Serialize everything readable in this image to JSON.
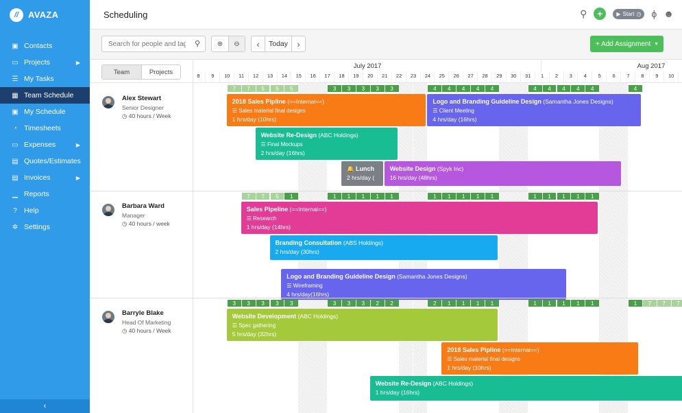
{
  "app": {
    "brand": "AVAZA",
    "logo_letter": "//"
  },
  "sidebar": {
    "items": [
      {
        "label": "Contacts",
        "icon": "contact-card-icon"
      },
      {
        "label": "Projects",
        "icon": "folder-icon",
        "has_submenu": true
      },
      {
        "label": "My Tasks",
        "icon": "task-list-icon"
      },
      {
        "label": "Team Schedule",
        "icon": "calendar-icon",
        "active": true
      },
      {
        "label": "My Schedule",
        "icon": "calendar-check-icon"
      },
      {
        "label": "Timesheets",
        "icon": "stopwatch-icon"
      },
      {
        "label": "Expenses",
        "icon": "receipt-icon",
        "has_submenu": true
      },
      {
        "label": "Quotes/Estimates",
        "icon": "document-icon"
      },
      {
        "label": "Invoices",
        "icon": "invoice-icon",
        "has_submenu": true
      },
      {
        "label": "Reports",
        "icon": "chart-icon"
      },
      {
        "label": "Help",
        "icon": "help-icon"
      },
      {
        "label": "Settings",
        "icon": "gear-icon"
      }
    ],
    "collapse_glyph": "‹"
  },
  "header": {
    "title": "Scheduling",
    "timer_label": "Start"
  },
  "toolbar": {
    "search_placeholder": "Search for people and tags...",
    "today_label": "Today",
    "add_label": "+ Add Assignment"
  },
  "tabs": {
    "team": "Team",
    "projects": "Projects"
  },
  "timeline": {
    "months": [
      {
        "label": "July 2017",
        "start_index": 0,
        "span": 24
      },
      {
        "label": "Aug 2017",
        "start_index": 24,
        "span": 10
      }
    ],
    "days": [
      "8",
      "9",
      "10",
      "11",
      "12",
      "13",
      "14",
      "15",
      "16",
      "17",
      "18",
      "19",
      "20",
      "21",
      "22",
      "23",
      "24",
      "25",
      "26",
      "27",
      "28",
      "29",
      "30",
      "31",
      "1",
      "2",
      "3",
      "4",
      "5",
      "6",
      "7",
      "8",
      "9",
      "10"
    ]
  },
  "people": [
    {
      "name": "Alex Stewart",
      "role": "Senior Designer",
      "hours": "40 hours / Week",
      "availability": [
        {
          "start": 2,
          "values": [
            "7",
            "7",
            "5",
            "5",
            "5"
          ],
          "shade": [
            "light",
            "light",
            "light",
            "light",
            "light"
          ]
        },
        {
          "start": 9,
          "values": [
            "3",
            "3",
            "3",
            "3",
            "3"
          ],
          "shade": [
            "dark",
            "dark",
            "dark",
            "dark",
            "dark"
          ]
        },
        {
          "start": 16,
          "values": [
            "4",
            "4",
            "4",
            "4",
            "4"
          ],
          "shade": [
            "dark",
            "dark",
            "dark",
            "dark",
            "dark"
          ]
        },
        {
          "start": 23,
          "values": [
            "4",
            "4",
            "4",
            "4",
            "4"
          ],
          "shade": [
            "dark",
            "dark",
            "dark",
            "dark",
            "dark"
          ]
        },
        {
          "start": 30,
          "values": [
            "4"
          ],
          "shade": [
            "dark"
          ]
        }
      ],
      "assignments": [
        {
          "title": "2018 Sales Pipline",
          "client": "(==Internal==)",
          "task": "Sales material final designs",
          "hours": "1 hrs/day (10hrs)",
          "color": "#f97b16",
          "start": 2,
          "end": 16,
          "lane": 0
        },
        {
          "title": "Logo and Branding Guideline Design",
          "client": "(Samantha Jones Designs)",
          "task": "Client Meeting",
          "hours": "4 hrs/day (16hrs)",
          "color": "#6764ee",
          "start": 16,
          "end": 31,
          "lane": 0
        },
        {
          "title": "Website Re-Design",
          "client": "(ABC Holdings)",
          "task": "Final Mockups",
          "hours": "2 hrs/day (16hrs)",
          "color": "#19bd94",
          "start": 4,
          "end": 14,
          "lane": 1
        },
        {
          "title": "Lunch",
          "client": "",
          "task": "",
          "hours": "2 hrs/day (",
          "color": "#7b8087",
          "start": 10,
          "end": 13,
          "lane": 2,
          "icon": "bell-icon"
        },
        {
          "title": "Website Design",
          "client": "(Spyk Inc)",
          "task": "",
          "hours": "16 hrs/day (48hrs)",
          "color": "#b657e0",
          "start": 13,
          "end": 29.6,
          "lane": 2
        }
      ]
    },
    {
      "name": "Barbara Ward",
      "role": "Manager",
      "hours": "40 hours / week",
      "availability": [
        {
          "start": 3,
          "values": [
            "7",
            "7",
            "5",
            "1"
          ],
          "shade": [
            "light",
            "light",
            "light",
            "dark"
          ]
        },
        {
          "start": 9,
          "values": [
            "1",
            "1",
            "1",
            "1",
            "1"
          ],
          "shade": [
            "dark",
            "dark",
            "dark",
            "dark",
            "dark"
          ]
        },
        {
          "start": 16,
          "values": [
            "1",
            "1",
            "1",
            "1",
            "1"
          ],
          "shade": [
            "dark",
            "dark",
            "dark",
            "dark",
            "dark"
          ]
        },
        {
          "start": 23,
          "values": [
            "1",
            "1",
            "1",
            "1",
            "1"
          ],
          "shade": [
            "dark",
            "dark",
            "dark",
            "dark",
            "dark"
          ]
        }
      ],
      "assignments": [
        {
          "title": "Sales Pipeline",
          "client": "(==Internal==)",
          "task": "Research",
          "hours": "1 hrs/day (14hrs)",
          "color": "#e33c96",
          "start": 3,
          "end": 28,
          "lane": 0
        },
        {
          "title": "Branding Consultation",
          "client": "(ABS Holdings)",
          "task": "",
          "hours": "2 hrs/day (30hrs)",
          "color": "#18aaf0",
          "start": 5,
          "end": 21,
          "lane": 1
        },
        {
          "title": "Logo and Branding Guideline Design",
          "client": "(Samantha Jones Designs)",
          "task": "Wireframing",
          "hours": "4 hrs/day(16hrs)",
          "color": "#6764ee",
          "start": 5.8,
          "end": 25.8,
          "lane": 2
        }
      ]
    },
    {
      "name": "Barryle Blake",
      "role": "Head Of Marketing",
      "hours": "40 hours / Week",
      "availability": [
        {
          "start": 2,
          "values": [
            "3",
            "3",
            "3",
            "3",
            "3"
          ],
          "shade": [
            "dark",
            "dark",
            "dark",
            "dark",
            "dark"
          ]
        },
        {
          "start": 9,
          "values": [
            "3",
            "3",
            "3",
            "2",
            "2"
          ],
          "shade": [
            "dark",
            "dark",
            "dark",
            "dark",
            "dark"
          ]
        },
        {
          "start": 16,
          "values": [
            "2",
            "1",
            "1",
            "1",
            "1"
          ],
          "shade": [
            "dark",
            "dark",
            "dark",
            "dark",
            "dark"
          ]
        },
        {
          "start": 23,
          "values": [
            "1",
            "1",
            "1",
            "1",
            "1"
          ],
          "shade": [
            "dark",
            "dark",
            "dark",
            "dark",
            "dark"
          ]
        },
        {
          "start": 30,
          "values": [
            "1",
            "7",
            "7",
            "7"
          ],
          "shade": [
            "dark",
            "light",
            "light",
            "light"
          ]
        }
      ],
      "assignments": [
        {
          "title": "Website Development",
          "client": "(ABC Holdings)",
          "task": "Spec gathering",
          "hours": "5 hrs/day (32hrs)",
          "color": "#a4c93a",
          "start": 2,
          "end": 21,
          "lane": 0
        },
        {
          "title": "2018 Sales Pipline",
          "client": "(==Internal==)",
          "task": "Sales material final designs",
          "hours": "1 hrs/day (10hrs)",
          "color": "#f97b16",
          "start": 17,
          "end": 30.8,
          "lane": 1
        },
        {
          "title": "Website Re-Design",
          "client": "(ABC Holdings)",
          "task": "",
          "hours": "1 hrs/day (16hrs)",
          "color": "#19bd94",
          "start": 12,
          "end": 34,
          "lane": 2
        }
      ]
    }
  ]
}
